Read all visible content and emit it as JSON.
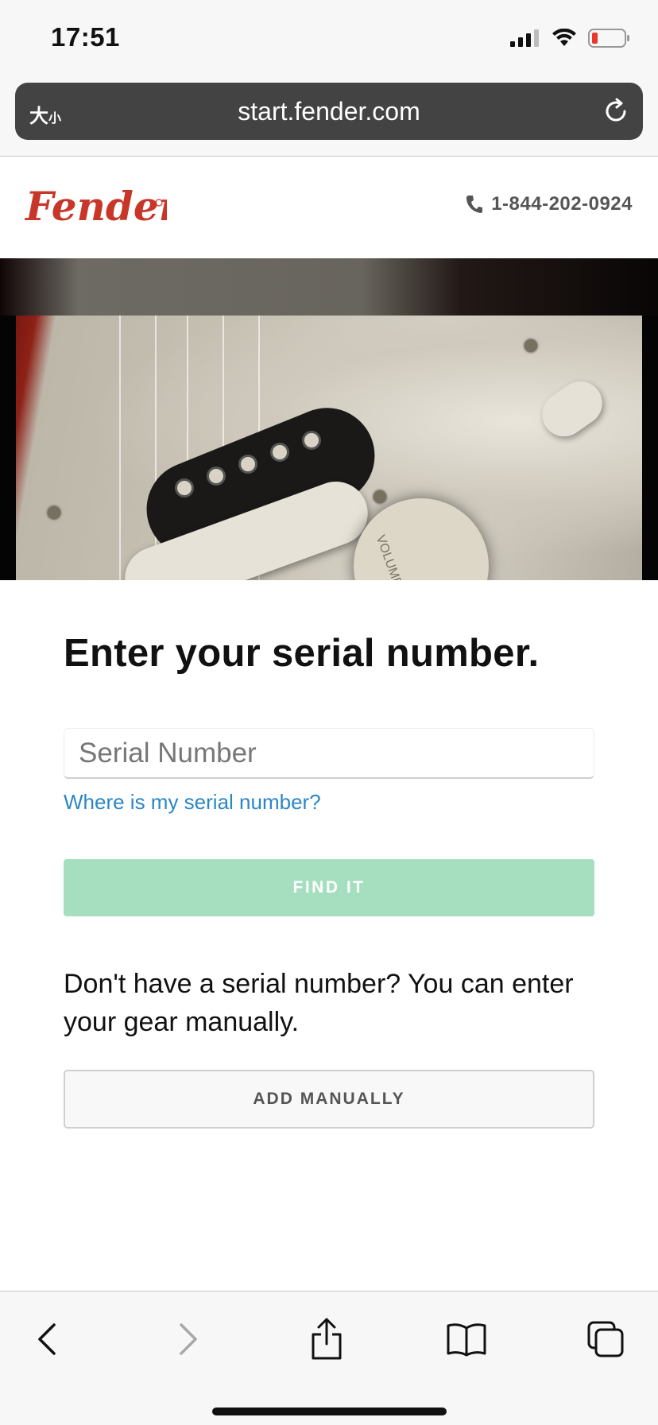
{
  "status_bar": {
    "time": "17:51",
    "icons": [
      "cellular-signal-icon",
      "wifi-icon",
      "battery-low-icon"
    ]
  },
  "browser": {
    "text_size_label": "大",
    "text_size_small": "小",
    "url": "start.fender.com",
    "reload_icon": "reload-icon"
  },
  "header": {
    "logo_text": "Fender",
    "phone_icon": "phone-icon",
    "phone": "1-844-202-0924"
  },
  "hero": {
    "knob_text": "VOLUME"
  },
  "form": {
    "title": "Enter your serial number.",
    "serial_value": "",
    "serial_placeholder": "Serial Number",
    "help_link": "Where is my serial number?",
    "find_button": "FIND IT",
    "manual_text": "Don't have a serial number? You can enter your gear manually.",
    "manual_button": "ADD MANUALLY"
  },
  "toolbar": {
    "items": [
      "back-icon",
      "forward-icon",
      "share-icon",
      "bookmarks-icon",
      "tabs-icon"
    ]
  },
  "colors": {
    "brand_red": "#c8362a",
    "link_blue": "#2b86c5",
    "find_button_bg": "#a6dfbf",
    "url_bar_bg": "#434343"
  }
}
